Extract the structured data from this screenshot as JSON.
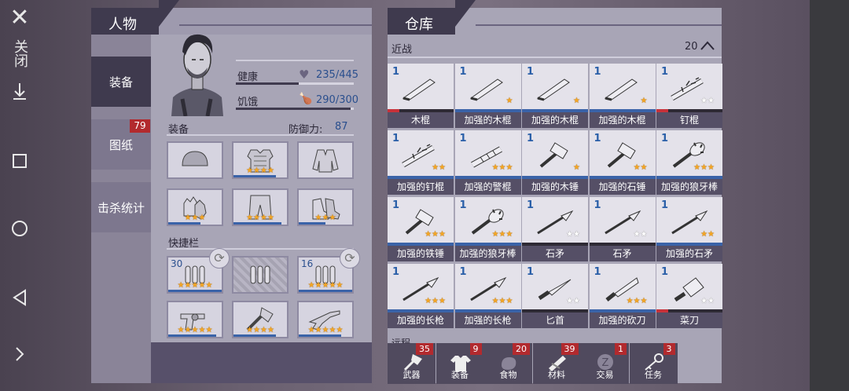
{
  "character": {
    "title": "人物",
    "tabs": [
      "装备",
      "图纸",
      "击杀统计"
    ],
    "blueprint_badge": "79",
    "health_label": "健康",
    "health_value": "235/445",
    "health_pct": 0.53,
    "hunger_label": "饥饿",
    "hunger_value": "290/300",
    "hunger_pct": 0.97,
    "equip_label": "装备",
    "defense_label": "防御力:",
    "defense_value": "87",
    "quickbar_label": "快捷栏",
    "equip_slots": [
      {
        "icon": "helmet-icon",
        "stars": "",
        "bar": 0
      },
      {
        "icon": "chest-armor-icon",
        "stars": "★★★★",
        "bar": 0.8
      },
      {
        "icon": "jacket-icon",
        "stars": "",
        "bar": 0
      },
      {
        "icon": "gloves-icon",
        "stars": "★★★",
        "bar": 0.6
      },
      {
        "icon": "pants-icon",
        "stars": "★★★★",
        "bar": 0.9
      },
      {
        "icon": "boots-icon",
        "stars": "★★★",
        "bar": 0.5
      }
    ],
    "quick_slots": [
      {
        "icon": "ammo-icon",
        "count": "30",
        "stars": "★★★★★",
        "bar": 1
      },
      {
        "icon": "ammo-icon",
        "count": "",
        "stars": "",
        "bar": 0,
        "empty": true
      },
      {
        "icon": "ammo-icon",
        "count": "16",
        "stars": "★★★★★",
        "bar": 1
      },
      {
        "icon": "revolver-icon",
        "count": "",
        "stars": "★★★★★",
        "bar": 0.9
      },
      {
        "icon": "axe-icon",
        "count": "",
        "stars": "★★★★",
        "bar": 0.8
      },
      {
        "icon": "shotgun-icon",
        "count": "",
        "stars": "★★★★★",
        "bar": 0.8
      }
    ]
  },
  "warehouse": {
    "title": "仓库",
    "section": "近战",
    "section_count": "20",
    "next_section": "远程",
    "items": [
      {
        "count": "1",
        "name": "木棍",
        "stars": "",
        "bar": "red"
      },
      {
        "count": "1",
        "name": "加强的木棍",
        "stars": "★",
        "bar": "blue"
      },
      {
        "count": "1",
        "name": "加强的木棍",
        "stars": "★",
        "bar": "blue"
      },
      {
        "count": "1",
        "name": "加强的木棍",
        "stars": "★",
        "bar": "blue"
      },
      {
        "count": "1",
        "name": "钉棍",
        "stars": "★★",
        "white": true,
        "bar": "red"
      },
      {
        "count": "1",
        "name": "加强的钉棍",
        "stars": "★★",
        "bar": "blue"
      },
      {
        "count": "1",
        "name": "加强的警棍",
        "stars": "★★★",
        "bar": "blue"
      },
      {
        "count": "1",
        "name": "加强的木锤",
        "stars": "★",
        "bar": "blue"
      },
      {
        "count": "1",
        "name": "加强的石锤",
        "stars": "★★",
        "bar": "blue"
      },
      {
        "count": "1",
        "name": "加强的狼牙棒",
        "stars": "★★★",
        "bar": "blue"
      },
      {
        "count": "1",
        "name": "加强的铁锤",
        "stars": "★★★",
        "bar": "blue"
      },
      {
        "count": "1",
        "name": "加强的狼牙棒",
        "stars": "★★★",
        "bar": "blue"
      },
      {
        "count": "1",
        "name": "石矛",
        "stars": "★★",
        "white": true,
        "bar": "dark"
      },
      {
        "count": "1",
        "name": "石矛",
        "stars": "★★",
        "white": true,
        "bar": "dark"
      },
      {
        "count": "1",
        "name": "加强的石矛",
        "stars": "★★",
        "bar": "blue"
      },
      {
        "count": "1",
        "name": "加强的长枪",
        "stars": "★★★",
        "bar": "blue"
      },
      {
        "count": "1",
        "name": "加强的长枪",
        "stars": "★★★",
        "bar": "blue"
      },
      {
        "count": "1",
        "name": "匕首",
        "stars": "★★",
        "white": true,
        "bar": "dark"
      },
      {
        "count": "1",
        "name": "加强的砍刀",
        "stars": "★★★",
        "bar": "blue"
      },
      {
        "count": "1",
        "name": "菜刀",
        "stars": "★★",
        "white": true,
        "bar": "red"
      }
    ],
    "bottom_tabs": [
      {
        "label": "武器",
        "badge": "35",
        "icon": "axe-icon"
      },
      {
        "label": "装备",
        "badge": "9",
        "icon": "shirt-icon"
      },
      {
        "label": "食物",
        "badge": "20",
        "icon": "food-icon"
      },
      {
        "label": "材料",
        "badge": "39",
        "icon": "material-icon"
      },
      {
        "label": "交易",
        "badge": "1",
        "icon": "coin-icon"
      },
      {
        "label": "任务",
        "badge": "3",
        "icon": "key-icon"
      }
    ]
  },
  "system": {
    "close_label": "关闭"
  }
}
